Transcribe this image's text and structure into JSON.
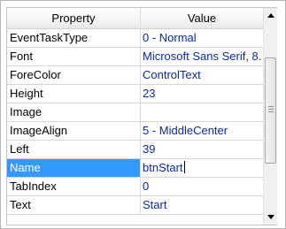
{
  "header": {
    "property_label": "Property",
    "value_label": "Value"
  },
  "rows": [
    {
      "property": "EventTaskType",
      "value": "0 - Normal"
    },
    {
      "property": "Font",
      "value": "Microsoft Sans Serif, 8."
    },
    {
      "property": "ForeColor",
      "value": "ControlText"
    },
    {
      "property": "Height",
      "value": "23"
    },
    {
      "property": "Image",
      "value": ""
    },
    {
      "property": "ImageAlign",
      "value": "5 - MiddleCenter"
    },
    {
      "property": "Left",
      "value": "39"
    },
    {
      "property": "Name",
      "value": "btnStart",
      "selected": true,
      "editing": true
    },
    {
      "property": "TabIndex",
      "value": "0"
    },
    {
      "property": "Text",
      "value": "Start"
    }
  ],
  "scrollbar": {
    "up_icon": "triangle-up-icon",
    "down_icon": "triangle-down-icon"
  },
  "colors": {
    "selection": "#3399ff",
    "value_text": "#0a2a9a",
    "grid_line": "#d6d6d6"
  }
}
